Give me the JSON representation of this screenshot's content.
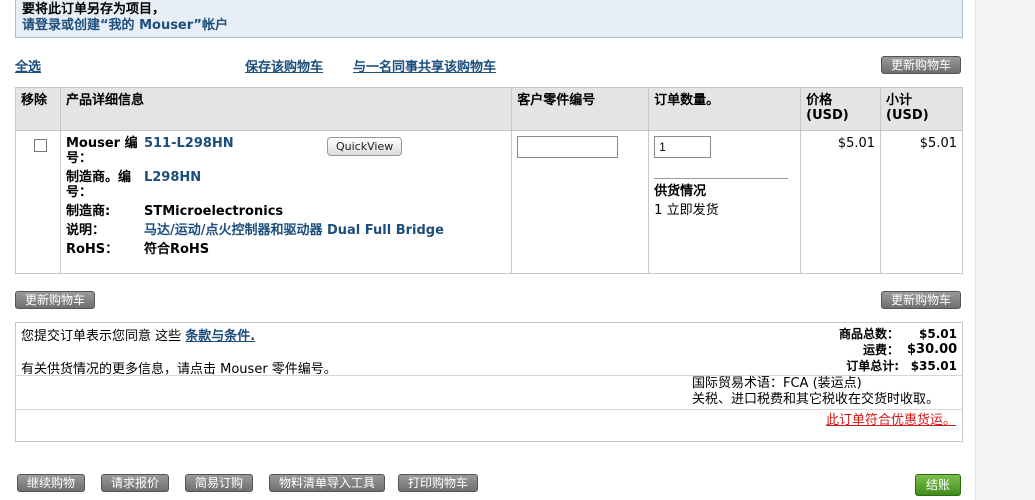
{
  "notice": {
    "line1": "要将此订单另存为项目，",
    "line2": "请登录或创建“我的 Mouser”帐户"
  },
  "links": {
    "select_all": "全选",
    "save_cart": "保存该购物车",
    "share_cart": "与一名同事共享该购物车"
  },
  "buttons": {
    "update_cart": "更新购物车",
    "quickview": "QuickView",
    "continue_shopping": "继续购物",
    "request_quote": "请求报价",
    "easy_order": "简易订购",
    "bom_import": "物料清单导入工具",
    "print_cart": "打印购物车",
    "checkout": "结账"
  },
  "table": {
    "headers": {
      "remove": "移除",
      "details": "产品详细信息",
      "customer_pn": "客户零件编号",
      "qty": "订单数量。",
      "price": "价格",
      "price_unit": "(USD)",
      "subtotal": "小计",
      "subtotal_unit": "(USD)"
    },
    "item": {
      "mouser_label": "Mouser 编号：",
      "mouser_no": "511-L298HN",
      "mfr_no_label": "制造商。编号：",
      "mfr_no": "L298HN",
      "mfr_label": "制造商:",
      "mfr": "STMicroelectronics",
      "desc_label": "说明：",
      "desc": "马达/运动/点火控制器和驱动器 Dual Full Bridge",
      "rohs_label": "RoHS：",
      "rohs": "符合RoHS",
      "customer_pn_value": "",
      "qty_value": "1",
      "availability_label": "供货情况",
      "availability_value": "1 立即发货",
      "price": "$5.01",
      "subtotal": "$5.01"
    }
  },
  "summary": {
    "terms_prefix": "您提交订单表示您同意 这些",
    "terms_link": "条款与条件.",
    "more_info": "有关供货情况的更多信息，请点击 Mouser 零件编号。",
    "merch_total_label": "商品总数：",
    "merch_total": "$5.01",
    "shipping_label": "运费：",
    "shipping": "$30.00",
    "order_total_label": "订单总计:",
    "order_total": "$35.01",
    "incoterms": "国际贸易术语：FCA (装运点)",
    "duties": "关税、进口税费和其它税收在交货时收取。",
    "promo_link": "此订单符合优惠货运。"
  }
}
